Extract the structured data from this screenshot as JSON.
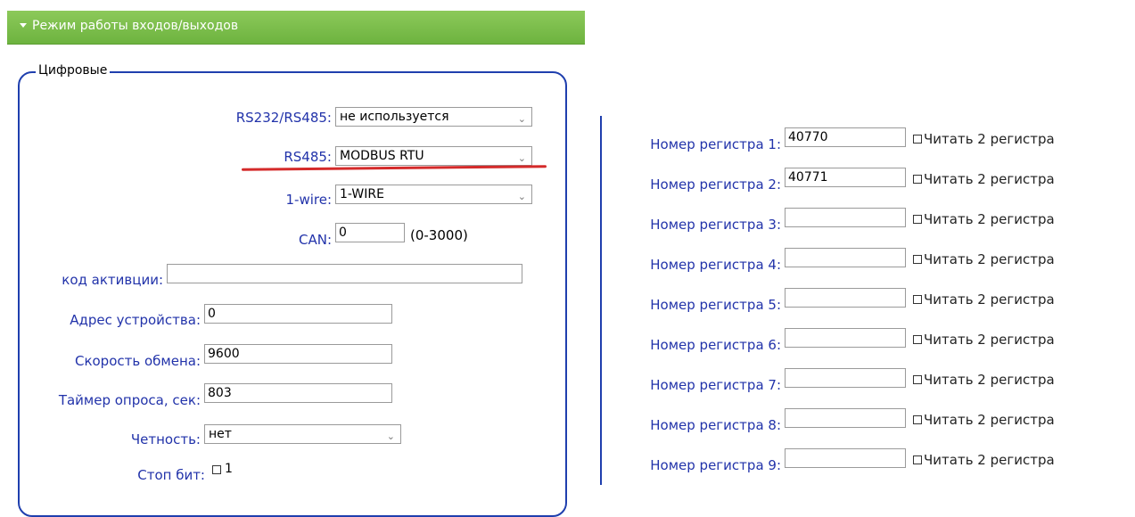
{
  "section": {
    "title": "Режим работы входов/выходов",
    "legend": "Цифровые"
  },
  "left_form": {
    "rs232": {
      "label": "RS232/RS485:",
      "value": "не используется"
    },
    "rs485": {
      "label": "RS485:",
      "value": "MODBUS RTU"
    },
    "onewire": {
      "label": "1-wire:",
      "value": "1-WIRE"
    },
    "can": {
      "label": "CAN:",
      "value": "0",
      "range": "(0-3000)"
    },
    "activation": {
      "label": "код активции:",
      "value": ""
    },
    "address": {
      "label": "Адрес устройства:",
      "value": "0"
    },
    "speed": {
      "label": "Скорость обмена:",
      "value": "9600"
    },
    "timer": {
      "label": "Таймер опроса, сек:",
      "value": "803"
    },
    "parity": {
      "label": "Четность:",
      "value": "нет"
    },
    "stopbit": {
      "label": "Стоп бит:",
      "option": "1"
    }
  },
  "registers": [
    {
      "label": "Номер регистра 1:",
      "value": "40770",
      "checkbox": "Читать 2 регистра"
    },
    {
      "label": "Номер регистра 2:",
      "value": "40771",
      "checkbox": "Читать 2 регистра"
    },
    {
      "label": "Номер регистра 3:",
      "value": "",
      "checkbox": "Читать 2 регистра"
    },
    {
      "label": "Номер регистра 4:",
      "value": "",
      "checkbox": "Читать 2 регистра"
    },
    {
      "label": "Номер регистра 5:",
      "value": "",
      "checkbox": "Читать 2 регистра"
    },
    {
      "label": "Номер регистра 6:",
      "value": "",
      "checkbox": "Читать 2 регистра"
    },
    {
      "label": "Номер регистра 7:",
      "value": "",
      "checkbox": "Читать 2 регистра"
    },
    {
      "label": "Номер регистра 8:",
      "value": "",
      "checkbox": "Читать 2 регистра"
    },
    {
      "label": "Номер регистра 9:",
      "value": "",
      "checkbox": "Читать 2 регистра"
    }
  ],
  "colors": {
    "header_green": "#7cbd4c",
    "label_blue": "#2233aa",
    "border_blue": "#1f3fae",
    "underline_red": "#d42a2a"
  }
}
